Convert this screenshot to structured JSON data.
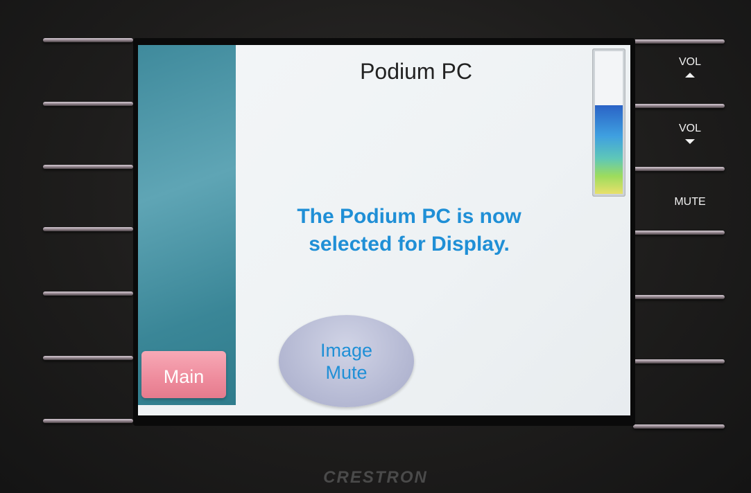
{
  "screen": {
    "title": "Podium PC",
    "message_line1": "The Podium PC is now",
    "message_line2": "selected for Display.",
    "main_button_label": "Main",
    "image_mute_line1": "Image",
    "image_mute_line2": "Mute",
    "volume_level": 0.62
  },
  "hard_buttons": {
    "vol_up_label": "VOL",
    "vol_down_label": "VOL",
    "mute_label": "MUTE"
  },
  "brand": "CRESTRON",
  "colors": {
    "accent_text": "#1f8fd6",
    "sidebar": "#4a95a7",
    "main_button": "#ee8b9c",
    "image_mute_button": "#b9bdd6"
  },
  "icons": {
    "vol_up": "triangle-up-icon",
    "vol_down": "triangle-down-icon"
  }
}
